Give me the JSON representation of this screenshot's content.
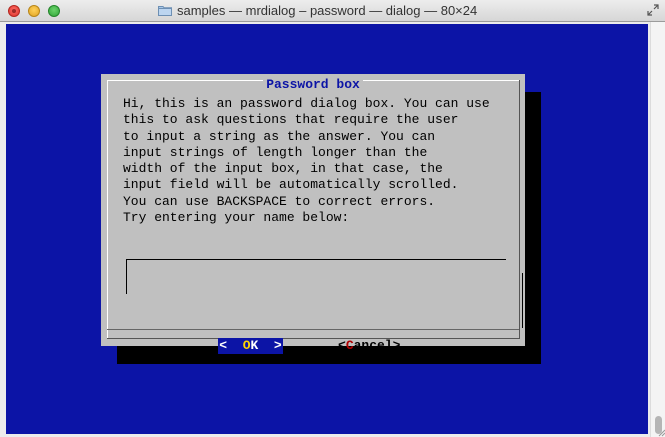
{
  "window": {
    "title": "samples — mrdialog – password — dialog — 80×24"
  },
  "colors": {
    "terminal_bg": "#0c14a6",
    "dialog_bg": "#c0c0c0",
    "title_text": "#0c14a6",
    "ok_button_bg": "#0c14a6",
    "hotkey_ok": "#ffd400",
    "hotkey_cancel": "#b00000"
  },
  "dialog": {
    "title": "Password box",
    "lines": [
      "Hi, this is an password dialog box. You can use",
      "this to ask questions that require the user",
      "to input a string as the answer. You can",
      "input strings of length longer than the",
      "width of the input box, in that case, the",
      "input field will be automatically scrolled.",
      "You can use BACKSPACE to correct errors.",
      "Try entering your name below:"
    ],
    "input_value": "",
    "buttons": {
      "ok": {
        "left": "<  ",
        "hot": "O",
        "rest": "K",
        "right": "  >"
      },
      "cancel": {
        "left": "<",
        "hot": "C",
        "rest": "ancel>"
      }
    }
  }
}
